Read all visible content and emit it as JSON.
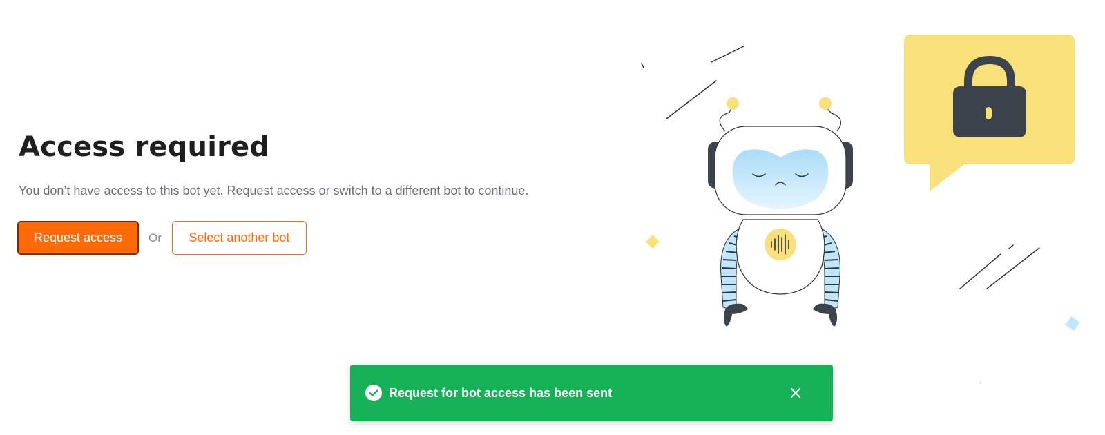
{
  "page": {
    "title": "Access required",
    "message": "You don’t have access to this bot yet. Request access or switch to a different bot to continue."
  },
  "actions": {
    "request_access_label": "Request access",
    "separator": "Or",
    "select_bot_label": "Select another bot"
  },
  "toast": {
    "message": "Request for bot access has been sent",
    "status_icon": "check-circle-icon",
    "close_icon": "close-icon"
  },
  "illustration": {
    "robot_icon": "sad-robot-illustration",
    "lock_icon": "lock-icon"
  },
  "colors": {
    "accent": "#ff6a09",
    "success": "#16b157",
    "speech_bubble": "#f8e07a",
    "lock": "#3c434b",
    "robot_visor": "#bfe6fb"
  }
}
